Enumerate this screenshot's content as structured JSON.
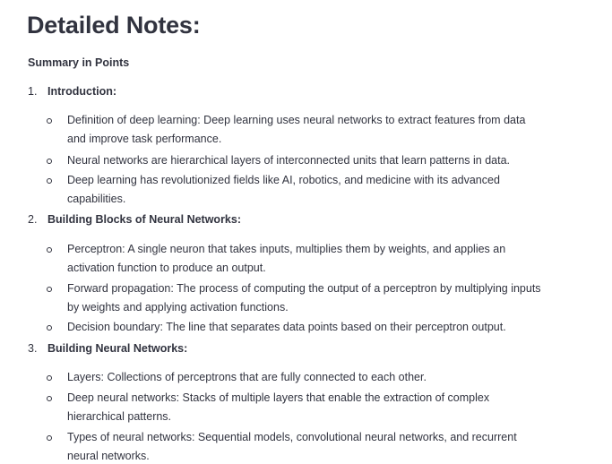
{
  "title": "Detailed Notes:",
  "subtitle": "Summary in Points",
  "sections": [
    {
      "number": "1.",
      "heading": "Introduction:",
      "bullets": [
        "Definition of deep learning: Deep learning uses neural networks to extract features from data and improve task performance.",
        "Neural networks are hierarchical layers of interconnected units that learn patterns in data.",
        "Deep learning has revolutionized fields like AI, robotics, and medicine with its advanced capabilities."
      ]
    },
    {
      "number": "2.",
      "heading": "Building Blocks of Neural Networks:",
      "bullets": [
        "Perceptron: A single neuron that takes inputs, multiplies them by weights, and applies an activation function to produce an output.",
        "Forward propagation: The process of computing the output of a perceptron by multiplying inputs by weights and applying activation functions.",
        "Decision boundary: The line that separates data points based on their perceptron output."
      ]
    },
    {
      "number": "3.",
      "heading": "Building Neural Networks:",
      "bullets": [
        "Layers: Collections of perceptrons that are fully connected to each other.",
        "Deep neural networks: Stacks of multiple layers that enable the extraction of complex hierarchical patterns.",
        "Types of neural networks: Sequential models, convolutional neural networks, and recurrent neural networks."
      ]
    }
  ]
}
